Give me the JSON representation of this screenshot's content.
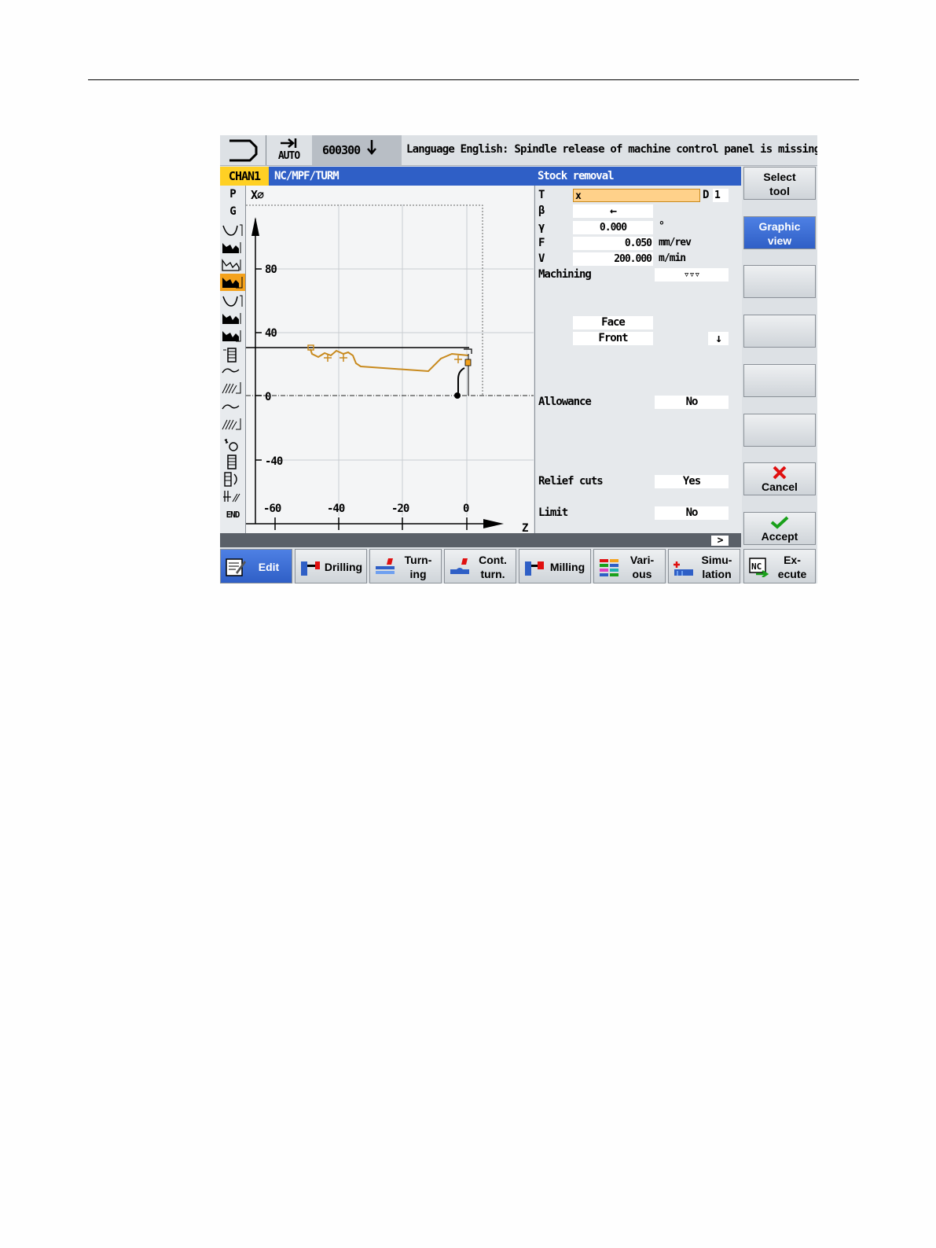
{
  "topbar": {
    "mode": "AUTO",
    "program": "600300",
    "message": "Language English: Spindle release of machine control panel is missing"
  },
  "header": {
    "channel": "CHAN1",
    "path": "NC/MPF/TURM",
    "cycle_title": "Stock removal"
  },
  "strip": {
    "p": "P",
    "g": "G",
    "end": "END"
  },
  "graphic": {
    "x_axis_label": "X⌀",
    "z_axis_label": "Z",
    "x_ticks": [
      "80",
      "40",
      "0",
      "-40"
    ],
    "z_ticks": [
      "-60",
      "-40",
      "-20",
      "0"
    ]
  },
  "form": {
    "t_label": "T",
    "t_value": "x",
    "d_label": "D",
    "d_value": "1",
    "beta_label": "β",
    "beta_value": "←",
    "gamma_label": "γ",
    "gamma_value": "0.000",
    "gamma_unit": "°",
    "f_label": "F",
    "f_value": "0.050",
    "f_unit": "mm/rev",
    "v_label": "V",
    "v_value": "200.000",
    "v_unit": "m/min",
    "machining_label": "Machining",
    "machining_value": "▿▿▿",
    "face_value": "Face",
    "front_value": "Front",
    "direction_value": "↓",
    "allowance_label": "Allowance",
    "allowance_value": "No",
    "relief_label": "Relief cuts",
    "relief_value": "Yes",
    "limit_label": "Limit",
    "limit_value": "No",
    "more_arrow": ">"
  },
  "right_softkeys": {
    "select_tool": "Select\ntool",
    "graphic_view": "Graphic\nview",
    "cancel": "Cancel",
    "accept": "Accept"
  },
  "bottom_softkeys": {
    "edit": "Edit",
    "drilling": "Drilling",
    "turning_1": "Turn-",
    "turning_2": "ing",
    "cont_1": "Cont.",
    "cont_2": "turn.",
    "milling": "Milling",
    "various_1": "Vari-",
    "various_2": "ous",
    "sim_1": "Simu-",
    "sim_2": "lation",
    "exec_1": "Ex-",
    "exec_2": "ecute"
  },
  "colors": {
    "accent_blue": "#2f5fc6",
    "channel_yellow": "#ffd024",
    "active_orange": "#f4a21c",
    "input_highlight": "#ffd18a",
    "contour": "#c88a1e"
  }
}
